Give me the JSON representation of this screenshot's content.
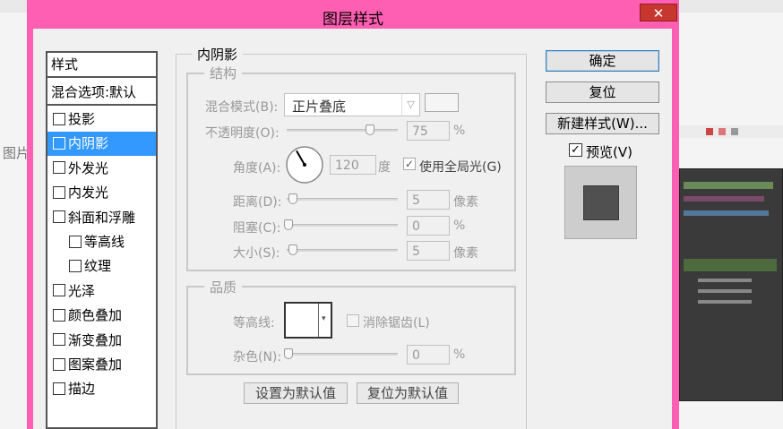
{
  "background": {
    "left_text": "图片"
  },
  "dialog": {
    "title": "图层样式",
    "close_label": "✕",
    "styles_list": {
      "header": "样式",
      "blend_options": "混合选项:默认",
      "items": [
        {
          "label": "投影",
          "checked": false,
          "selected": false
        },
        {
          "label": "内阴影",
          "checked": false,
          "selected": true
        },
        {
          "label": "外发光",
          "checked": false,
          "selected": false
        },
        {
          "label": "内发光",
          "checked": false,
          "selected": false
        },
        {
          "label": "斜面和浮雕",
          "checked": false,
          "selected": false
        },
        {
          "label": "等高线",
          "checked": false,
          "selected": false,
          "indent": true
        },
        {
          "label": "纹理",
          "checked": false,
          "selected": false,
          "indent": true
        },
        {
          "label": "光泽",
          "checked": false,
          "selected": false
        },
        {
          "label": "颜色叠加",
          "checked": false,
          "selected": false
        },
        {
          "label": "渐变叠加",
          "checked": false,
          "selected": false
        },
        {
          "label": "图案叠加",
          "checked": false,
          "selected": false
        },
        {
          "label": "描边",
          "checked": false,
          "selected": false
        }
      ]
    },
    "section_title": "内阴影",
    "structure": {
      "title": "结构",
      "blend_mode_label": "混合模式(B):",
      "blend_mode_value": "正片叠底",
      "opacity_label": "不透明度(O):",
      "opacity_value": "75",
      "opacity_unit": "%",
      "opacity_fraction": 0.75,
      "angle_label": "角度(A):",
      "angle_value": "120",
      "angle_unit": "度",
      "global_light_label": "使用全局光(G)",
      "global_light_checked": true,
      "distance_label": "距离(D):",
      "distance_value": "5",
      "distance_unit": "像素",
      "choke_label": "阻塞(C):",
      "choke_value": "0",
      "choke_unit": "%",
      "size_label": "大小(S):",
      "size_value": "5",
      "size_unit": "像素"
    },
    "quality": {
      "title": "品质",
      "contour_label": "等高线:",
      "antialias_label": "消除锯齿(L)",
      "antialias_checked": false,
      "noise_label": "杂色(N):",
      "noise_value": "0",
      "noise_unit": "%"
    },
    "buttons": {
      "make_default": "设置为默认值",
      "reset_default": "复位为默认值",
      "ok": "确定",
      "reset": "复位",
      "new_style": "新建样式(W)...",
      "preview_label": "预览(V)",
      "preview_checked": true
    }
  }
}
